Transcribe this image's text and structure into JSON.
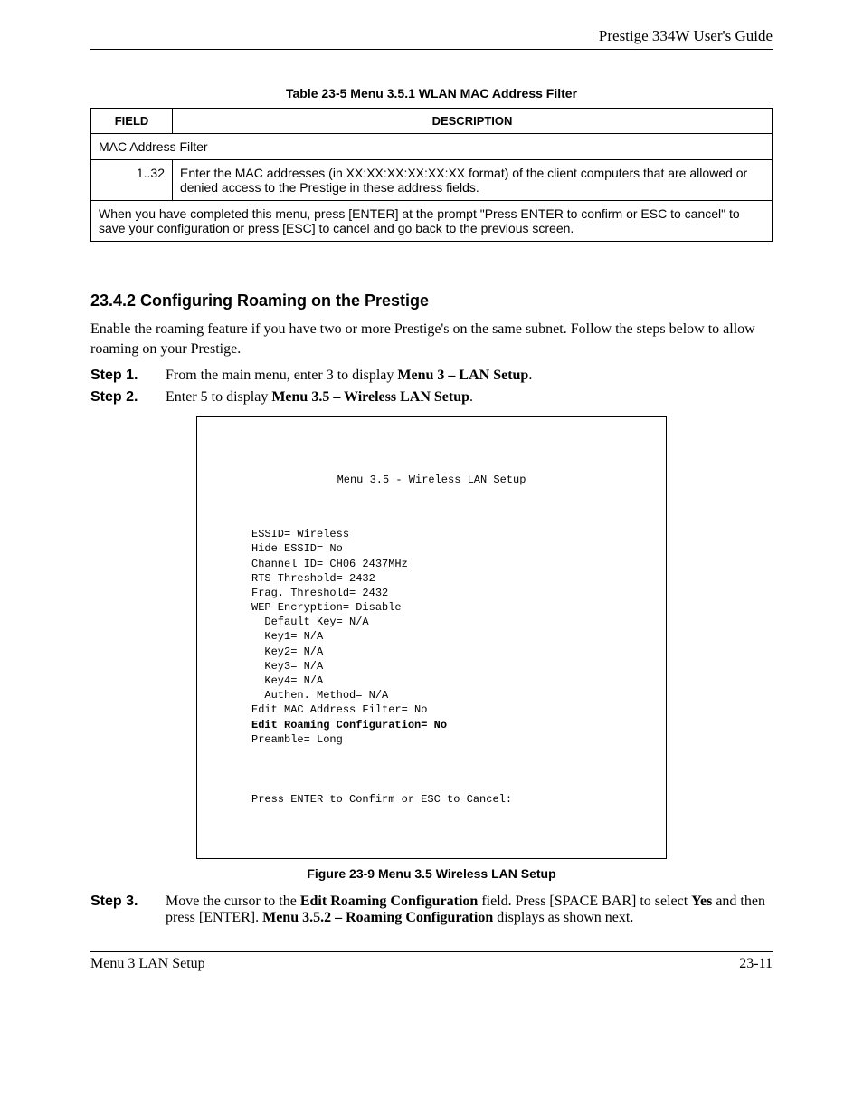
{
  "header": {
    "guide_title": "Prestige 334W User's Guide"
  },
  "table": {
    "caption": "Table 23-5 Menu 3.5.1 WLAN MAC Address Filter",
    "head_field": "FIELD",
    "head_desc": "DESCRIPTION",
    "row_mac_label": "MAC Address Filter",
    "row_range": "1..32",
    "row_range_desc": "Enter the MAC addresses (in XX:XX:XX:XX:XX:XX format) of the client computers that are allowed or denied access to the Prestige in these address fields.",
    "row_footer": "When you have completed this menu, press [ENTER] at the prompt \"Press ENTER to confirm or ESC to cancel\" to save your configuration or press [ESC] to cancel and go back to the previous screen."
  },
  "section": {
    "heading": "23.4.2 Configuring Roaming on the Prestige",
    "intro": "Enable the roaming feature if you have two or more Prestige's on the same subnet. Follow the steps below to allow roaming on your Prestige."
  },
  "steps": {
    "s1_label": "Step 1.",
    "s1_a": "From the main menu, enter 3 to display ",
    "s1_b": "Menu 3 – LAN Setup",
    "s1_c": ".",
    "s2_label": "Step 2.",
    "s2_a": "Enter 5 to display ",
    "s2_b": "Menu 3.5 – Wireless LAN Setup",
    "s2_c": ".",
    "s3_label": "Step 3.",
    "s3_a": "Move the cursor to the ",
    "s3_b": "Edit Roaming Configuration",
    "s3_c": " field. Press [",
    "s3_d": "SPACE BAR",
    "s3_e": "] to select ",
    "s3_f": "Yes",
    "s3_g": " and then press [",
    "s3_h": "ENTER",
    "s3_i": "]. ",
    "s3_j": "Menu 3.5.2 – Roaming Configuration",
    "s3_k": " displays as shown next."
  },
  "terminal": {
    "title": "Menu 3.5 - Wireless LAN Setup",
    "l1": "ESSID= Wireless",
    "l2": "Hide ESSID= No",
    "l3": "Channel ID= CH06 2437MHz",
    "l4": "RTS Threshold= 2432",
    "l5": "Frag. Threshold= 2432",
    "l6": "WEP Encryption= Disable",
    "l7": "  Default Key= N/A",
    "l8": "  Key1= N/A",
    "l9": "  Key2= N/A",
    "l10": "  Key3= N/A",
    "l11": "  Key4= N/A",
    "l12": "  Authen. Method= N/A",
    "l13": "Edit MAC Address Filter= No",
    "l14": "Edit Roaming Configuration= No",
    "l15": "Preamble= Long",
    "footer": "Press ENTER to Confirm or ESC to Cancel:"
  },
  "figure_caption": "Figure 23-9 Menu 3.5 Wireless LAN Setup",
  "footer": {
    "left": "Menu 3 LAN Setup",
    "right": "23-11"
  }
}
